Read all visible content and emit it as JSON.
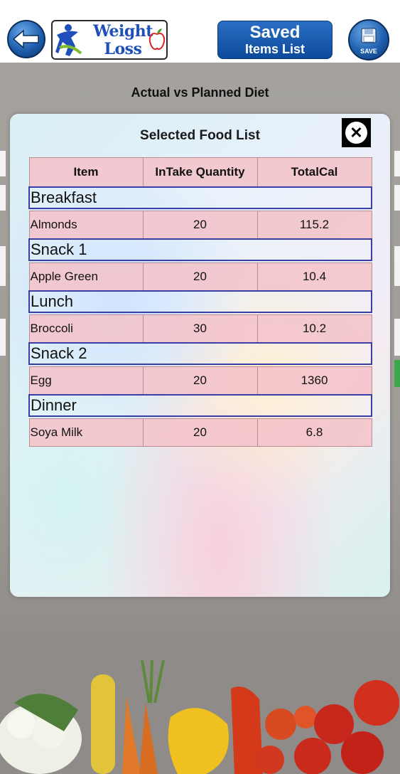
{
  "header": {
    "logo_text": "Weight Loss",
    "saved_button": {
      "line1": "Saved",
      "line2": "Items List"
    },
    "save_label": "SAVE"
  },
  "page_title": "Actual vs Planned Diet",
  "modal": {
    "title": "Selected Food List",
    "columns": [
      "Item",
      "InTake Quantity",
      "TotalCal"
    ],
    "meals": [
      {
        "name": "Breakfast",
        "item": "Almonds",
        "quantity": "20",
        "total_cal": "115.2"
      },
      {
        "name": "Snack 1",
        "item": "Apple Green",
        "quantity": "20",
        "total_cal": "10.4"
      },
      {
        "name": "Lunch",
        "item": "Broccoli",
        "quantity": "30",
        "total_cal": "10.2"
      },
      {
        "name": "Snack 2",
        "item": "Egg",
        "quantity": "20",
        "total_cal": "1360"
      },
      {
        "name": "Dinner",
        "item": "Soya Milk",
        "quantity": "20",
        "total_cal": "6.8"
      }
    ]
  },
  "colors": {
    "accent_blue": "#1f5fae",
    "row_pink": "#f4c4cb",
    "meal_border": "#3a3fa8"
  }
}
